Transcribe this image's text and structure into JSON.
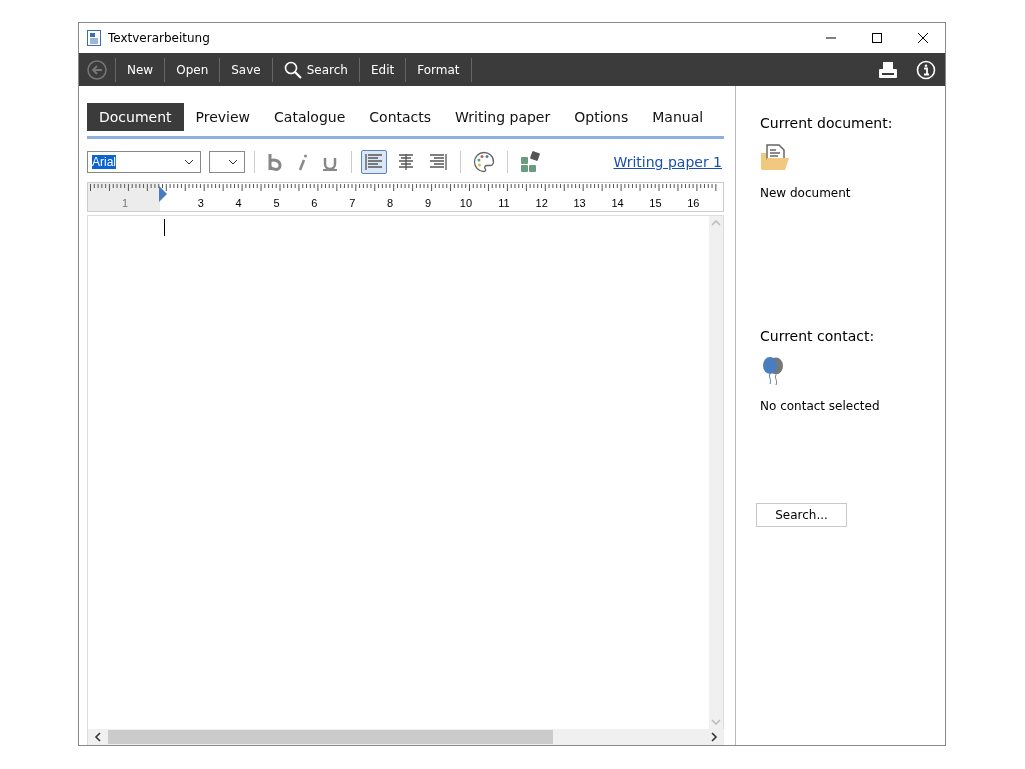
{
  "window": {
    "title": "Textverarbeitung"
  },
  "toolbar": {
    "items": [
      {
        "kind": "back",
        "disabled": true
      },
      {
        "kind": "text",
        "label": "New"
      },
      {
        "kind": "text",
        "label": "Open"
      },
      {
        "kind": "text",
        "label": "Save"
      },
      {
        "kind": "search",
        "label": "Search"
      },
      {
        "kind": "text",
        "label": "Edit"
      },
      {
        "kind": "text",
        "label": "Format"
      }
    ]
  },
  "tabs": [
    {
      "label": "Document",
      "selected": true
    },
    {
      "label": "Preview",
      "selected": false
    },
    {
      "label": "Catalogue",
      "selected": false
    },
    {
      "label": "Contacts",
      "selected": false
    },
    {
      "label": "Writing paper",
      "selected": false
    },
    {
      "label": "Options",
      "selected": false
    },
    {
      "label": "Manual",
      "selected": false
    }
  ],
  "format_bar": {
    "font": "Arial",
    "alignment": [
      {
        "kind": "left",
        "selected": true
      },
      {
        "kind": "center",
        "selected": false
      },
      {
        "kind": "right",
        "selected": false
      }
    ],
    "writing_paper_link": "Writing paper 1"
  },
  "ruler": {
    "numbers_before_indent": [
      "1"
    ],
    "numbers_after_indent": [
      "3",
      "4",
      "5",
      "6",
      "7",
      "8",
      "9",
      "10",
      "11",
      "12",
      "13",
      "14",
      "15",
      "16"
    ]
  },
  "side_panel": {
    "document_heading": "Current document:",
    "document_name": "New document",
    "contact_heading": "Current contact:",
    "contact_name": "No contact selected",
    "search_button": "Search..."
  }
}
